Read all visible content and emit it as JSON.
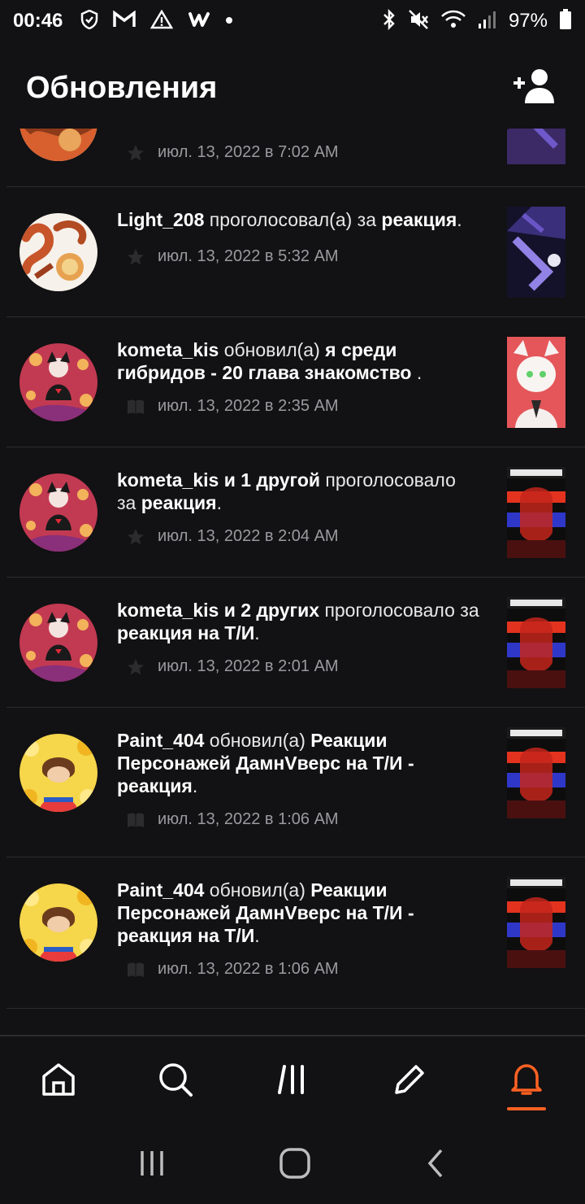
{
  "status_bar": {
    "time": "00:46",
    "battery": "97%",
    "icons_left": [
      "shield-icon",
      "gmail-icon",
      "warning-icon",
      "wattpad-icon",
      "dot-icon"
    ],
    "icons_right": [
      "bluetooth-icon",
      "mute-icon",
      "wifi-icon",
      "signal-icon",
      "battery-icon"
    ]
  },
  "header": {
    "title": "Обновления",
    "action_icon": "add-user-icon"
  },
  "accent_color": "#ff6122",
  "feed": {
    "items": [
      {
        "actor": "",
        "action": "",
        "target": "",
        "timestamp": "июл. 13, 2022 в 7:02 AM",
        "meta_icon": "star-icon"
      },
      {
        "actor": "Light_208",
        "action": "проголосовал(а) за",
        "target": "реакция",
        "suffix": ".",
        "timestamp": "июл. 13, 2022 в 5:32 AM",
        "meta_icon": "star-icon"
      },
      {
        "actor": "kometa_kis",
        "action": "обновил(а)",
        "target": "я среди гибридов - 20 глава знакомство",
        "suffix": " .",
        "timestamp": "июл. 13, 2022 в 2:35 AM",
        "meta_icon": "book-icon"
      },
      {
        "actor": "kometa_kis и 1 другой",
        "action": "проголосовало за",
        "target": "реакция",
        "suffix": ".",
        "timestamp": "июл. 13, 2022 в 2:04 AM",
        "meta_icon": "star-icon"
      },
      {
        "actor": "kometa_kis и 2 других",
        "action": "проголосовало за",
        "target": "реакция на Т/И",
        "suffix": ".",
        "timestamp": "июл. 13, 2022 в 2:01 AM",
        "meta_icon": "star-icon"
      },
      {
        "actor": "Paint_404",
        "action": "обновил(а)",
        "target": "Реакции Персонажей ДамнVверс на Т/И - реакция",
        "suffix": ".",
        "timestamp": "июл. 13, 2022 в 1:06 AM",
        "meta_icon": "book-icon"
      },
      {
        "actor": "Paint_404",
        "action": "обновил(а)",
        "target": "Реакции Персонажей ДамнVверс на Т/И - реакция на Т/И",
        "suffix": ".",
        "timestamp": "июл. 13, 2022 в 1:06 AM",
        "meta_icon": "book-icon"
      }
    ]
  },
  "bottom_nav": {
    "items": [
      {
        "icon": "home-icon",
        "active": false
      },
      {
        "icon": "search-icon",
        "active": false
      },
      {
        "icon": "library-icon",
        "active": false
      },
      {
        "icon": "pencil-icon",
        "active": false
      },
      {
        "icon": "bell-icon",
        "active": true
      }
    ]
  },
  "system_nav": {
    "items": [
      "recents-icon",
      "home-circle-icon",
      "back-icon"
    ]
  }
}
